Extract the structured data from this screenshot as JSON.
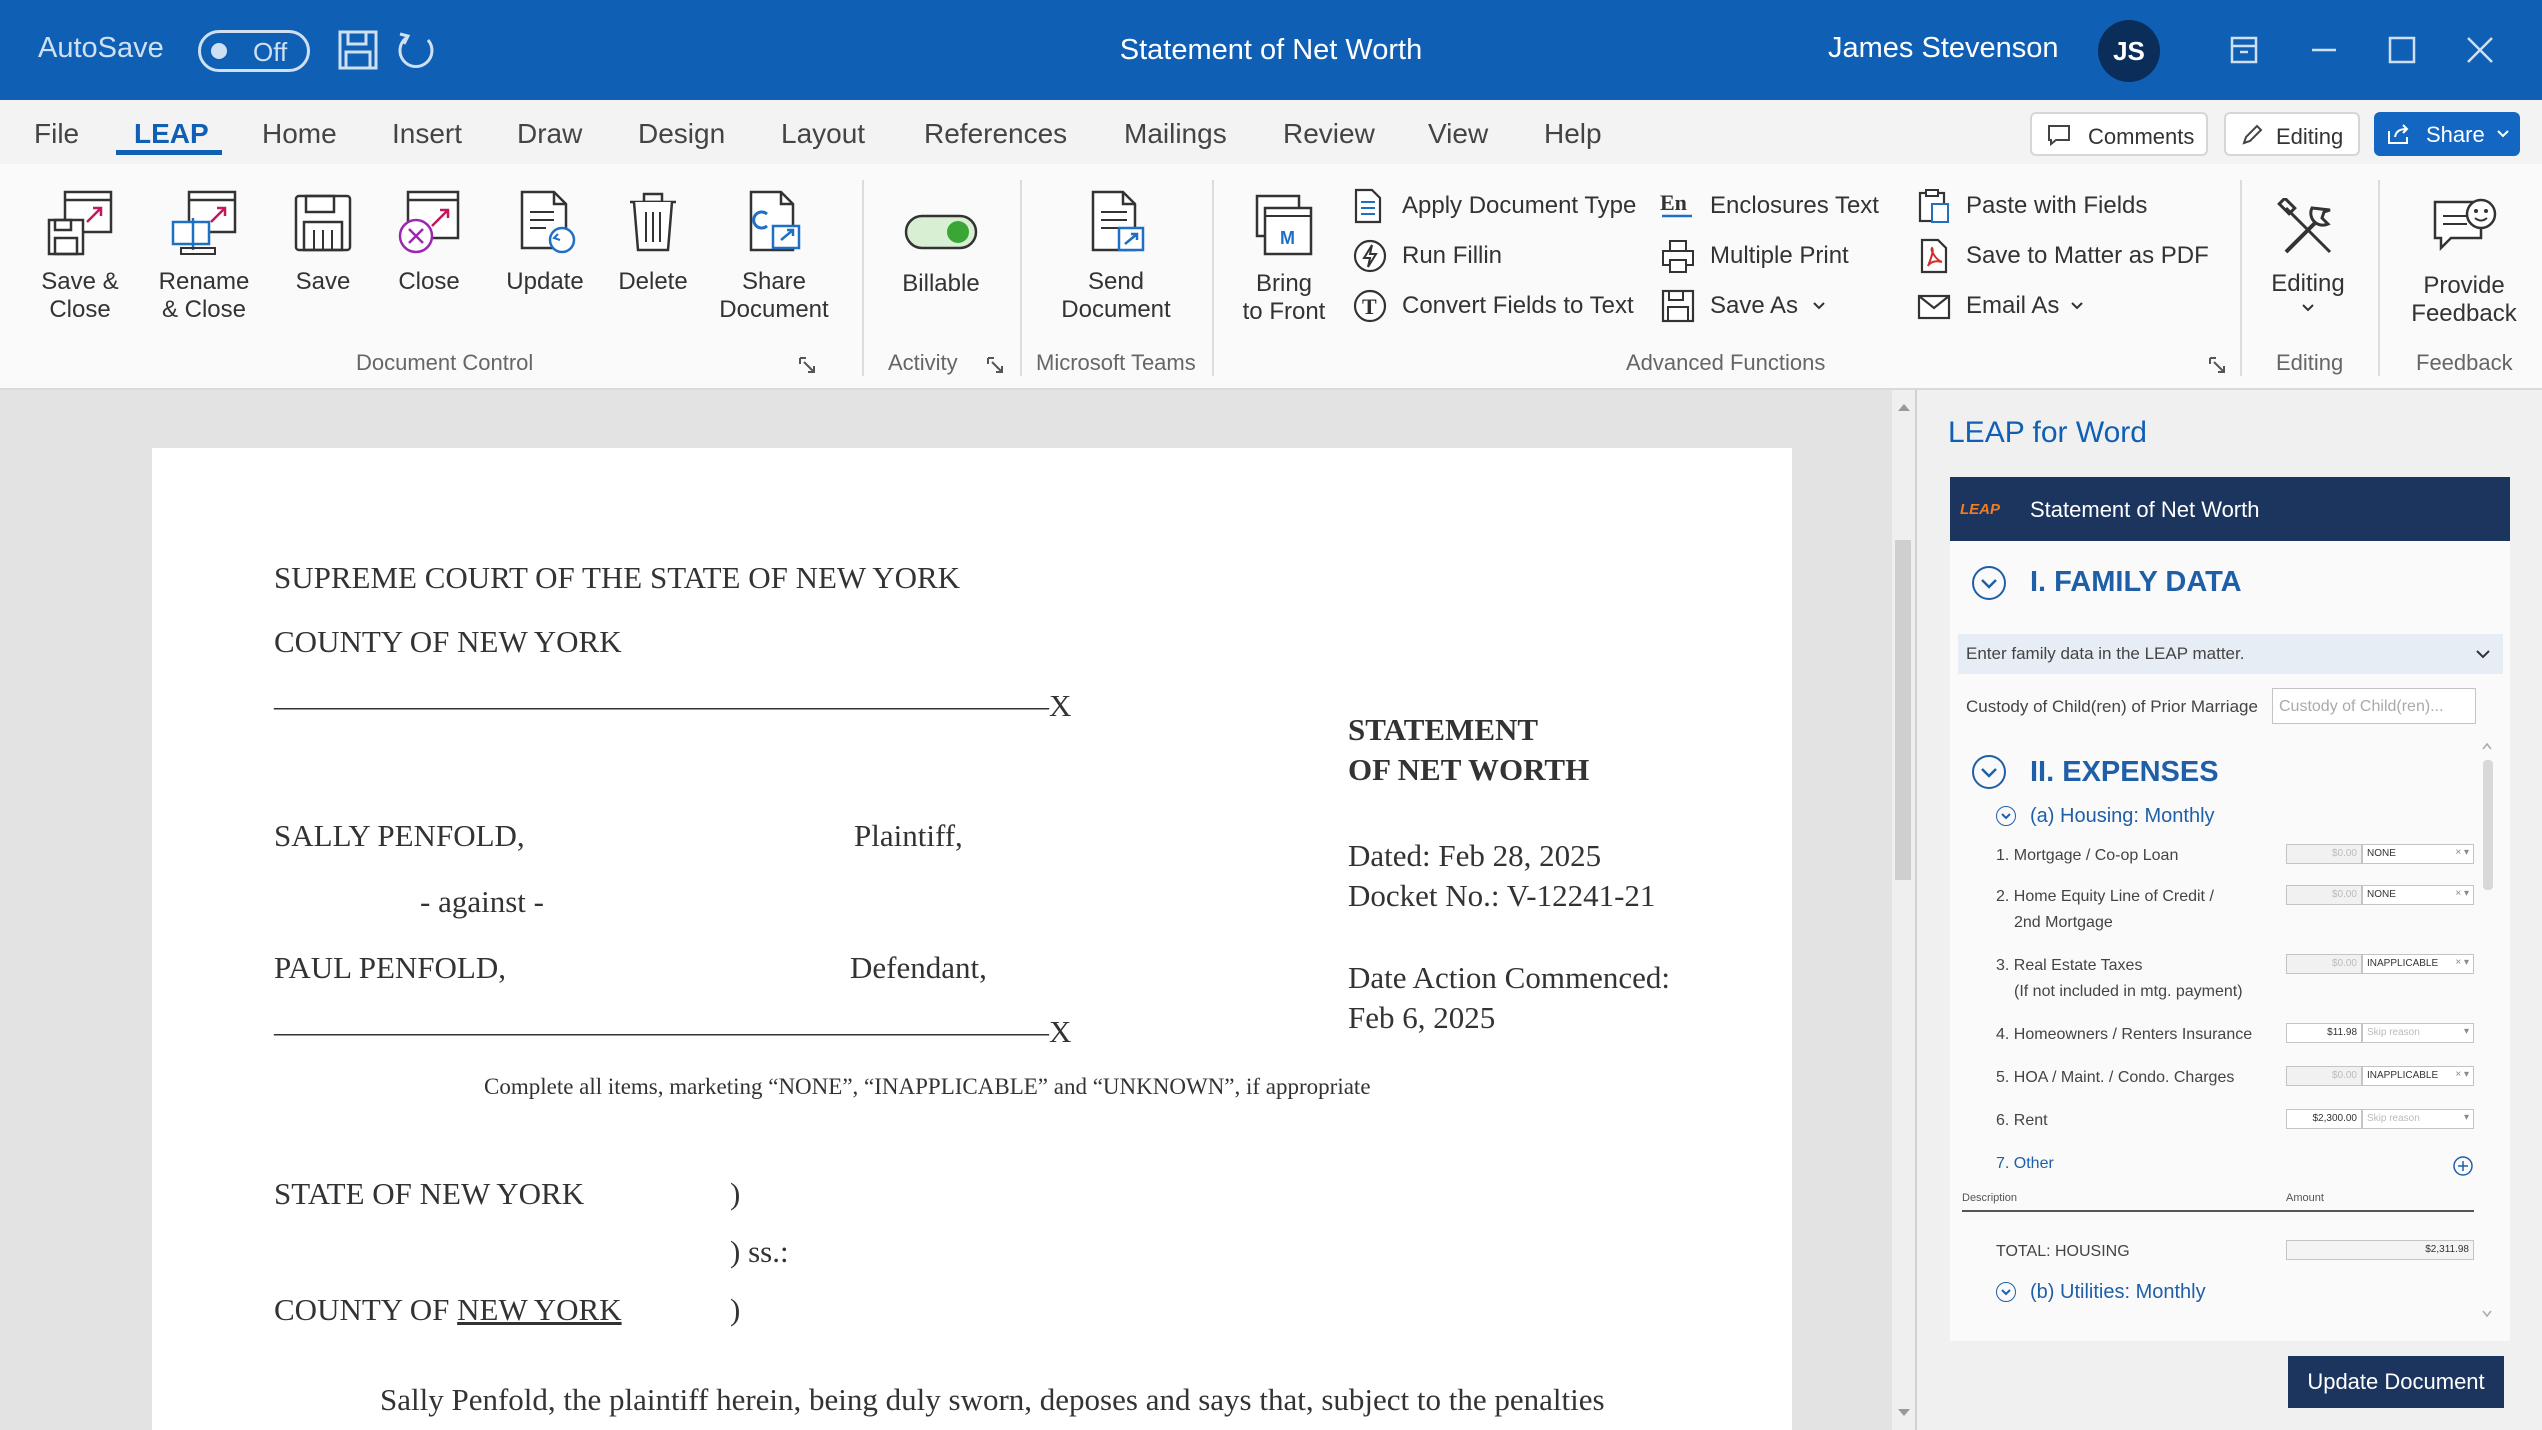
{
  "titlebar": {
    "autosave_label": "AutoSave",
    "autosave_state": "Off",
    "document_title": "Statement of Net Worth",
    "user_name": "James Stevenson",
    "user_initials": "JS"
  },
  "tabs": [
    "File",
    "LEAP",
    "Home",
    "Insert",
    "Draw",
    "Design",
    "Layout",
    "References",
    "Mailings",
    "Review",
    "View",
    "Help"
  ],
  "active_tab": "LEAP",
  "header_actions": {
    "comments": "Comments",
    "editing": "Editing",
    "share": "Share"
  },
  "ribbon": {
    "document_control": {
      "label": "Document Control",
      "buttons": [
        {
          "line1": "Save &",
          "line2": "Close",
          "icon": "save-close-icon"
        },
        {
          "line1": "Rename",
          "line2": "& Close",
          "icon": "rename-close-icon"
        },
        {
          "line1": "Save",
          "line2": "",
          "icon": "save-icon"
        },
        {
          "line1": "Close",
          "line2": "",
          "icon": "close-document-icon"
        },
        {
          "line1": "Update",
          "line2": "",
          "icon": "update-icon"
        },
        {
          "line1": "Delete",
          "line2": "",
          "icon": "trash-icon"
        },
        {
          "line1": "Share",
          "line2": "Document",
          "icon": "share-document-icon"
        }
      ]
    },
    "activity": {
      "label": "Activity",
      "billable": "Billable",
      "billable_on": true
    },
    "microsoft_teams": {
      "label": "Microsoft Teams",
      "line1": "Send",
      "line2": "Document"
    },
    "advanced_functions": {
      "label": "Advanced Functions",
      "bring_to_front": {
        "line1": "Bring",
        "line2": "to Front"
      },
      "col1": [
        "Apply Document Type",
        "Run Fillin",
        "Convert Fields to Text"
      ],
      "col2": [
        "Enclosures Text",
        "Multiple Print",
        "Save As"
      ],
      "col3": [
        "Paste with Fields",
        "Save to Matter as PDF",
        "Email As"
      ]
    },
    "editing": {
      "label": "Editing",
      "button": "Editing"
    },
    "feedback": {
      "label": "Feedback",
      "line1": "Provide",
      "line2": "Feedback"
    }
  },
  "document": {
    "court": "SUPREME COURT OF THE STATE OF NEW YORK",
    "county": "COUNTY OF NEW YORK",
    "divider": "—————————————————————————X",
    "statement_line1": "STATEMENT",
    "statement_line2": "OF NET WORTH",
    "plaintiff_name": "SALLY PENFOLD,",
    "plaintiff_role": "Plaintiff,",
    "against": "- against -",
    "defendant_name": "PAUL PENFOLD,",
    "defendant_role": "Defendant,",
    "dated": "Dated: Feb 28, 2025",
    "docket": "Docket No.: V-12241-21",
    "commenced_label": "Date Action Commenced:",
    "commenced_date": "Feb 6, 2025",
    "instructions": "Complete all items, marketing “NONE”, “INAPPLICABLE” and “UNKNOWN”, if appropriate",
    "state_line": "STATE OF NEW YORK",
    "paren1": ")",
    "ss": ") ss.:",
    "county_prefix": "COUNTY OF ",
    "county_underlined": "NEW YORK",
    "paren2": ")",
    "body": "Sally Penfold, the plaintiff herein, being duly sworn, deposes and says that, subject to the penalties"
  },
  "panel": {
    "title": "LEAP for Word",
    "brand": "LEAP",
    "header": "Statement of Net Worth",
    "family_title": "I. FAMILY DATA",
    "family_info": "Enter family data in the LEAP matter.",
    "custody_label": "Custody of Child(ren) of Prior Marriage",
    "custody_placeholder": "Custody of Child(ren)...",
    "expenses_title": "II. EXPENSES",
    "housing_title": "(a) Housing: Monthly",
    "items": [
      {
        "label": "1. Mortgage / Co-op Loan",
        "sub": "",
        "amount": "$0.00",
        "reason": "NONE",
        "filled": false
      },
      {
        "label": "2. Home Equity Line of Credit /",
        "sub": "2nd Mortgage",
        "amount": "$0.00",
        "reason": "NONE",
        "filled": false
      },
      {
        "label": "3. Real Estate Taxes",
        "sub": "(If not included in mtg. payment)",
        "amount": "$0.00",
        "reason": "INAPPLICABLE",
        "filled": false
      },
      {
        "label": "4. Homeowners / Renters Insurance",
        "sub": "",
        "amount": "$11.98",
        "reason": "Skip reason",
        "filled": true
      },
      {
        "label": "5. HOA / Maint. / Condo. Charges",
        "sub": "",
        "amount": "$0.00",
        "reason": "INAPPLICABLE",
        "filled": false
      },
      {
        "label": "6. Rent",
        "sub": "",
        "amount": "$2,300.00",
        "reason": "Skip reason",
        "filled": true
      }
    ],
    "other_label": "7. Other",
    "col_description": "Description",
    "col_amount": "Amount",
    "total_label": "TOTAL: HOUSING",
    "total_value": "$2,311.98",
    "utilities_title": "(b) Utilities: Monthly",
    "update_button": "Update Document"
  },
  "colors": {
    "brand_blue": "#0f5fb5",
    "panel_navy": "#1c355e",
    "toggle_green": "#3aa635",
    "leap_orange": "#f47b20"
  }
}
